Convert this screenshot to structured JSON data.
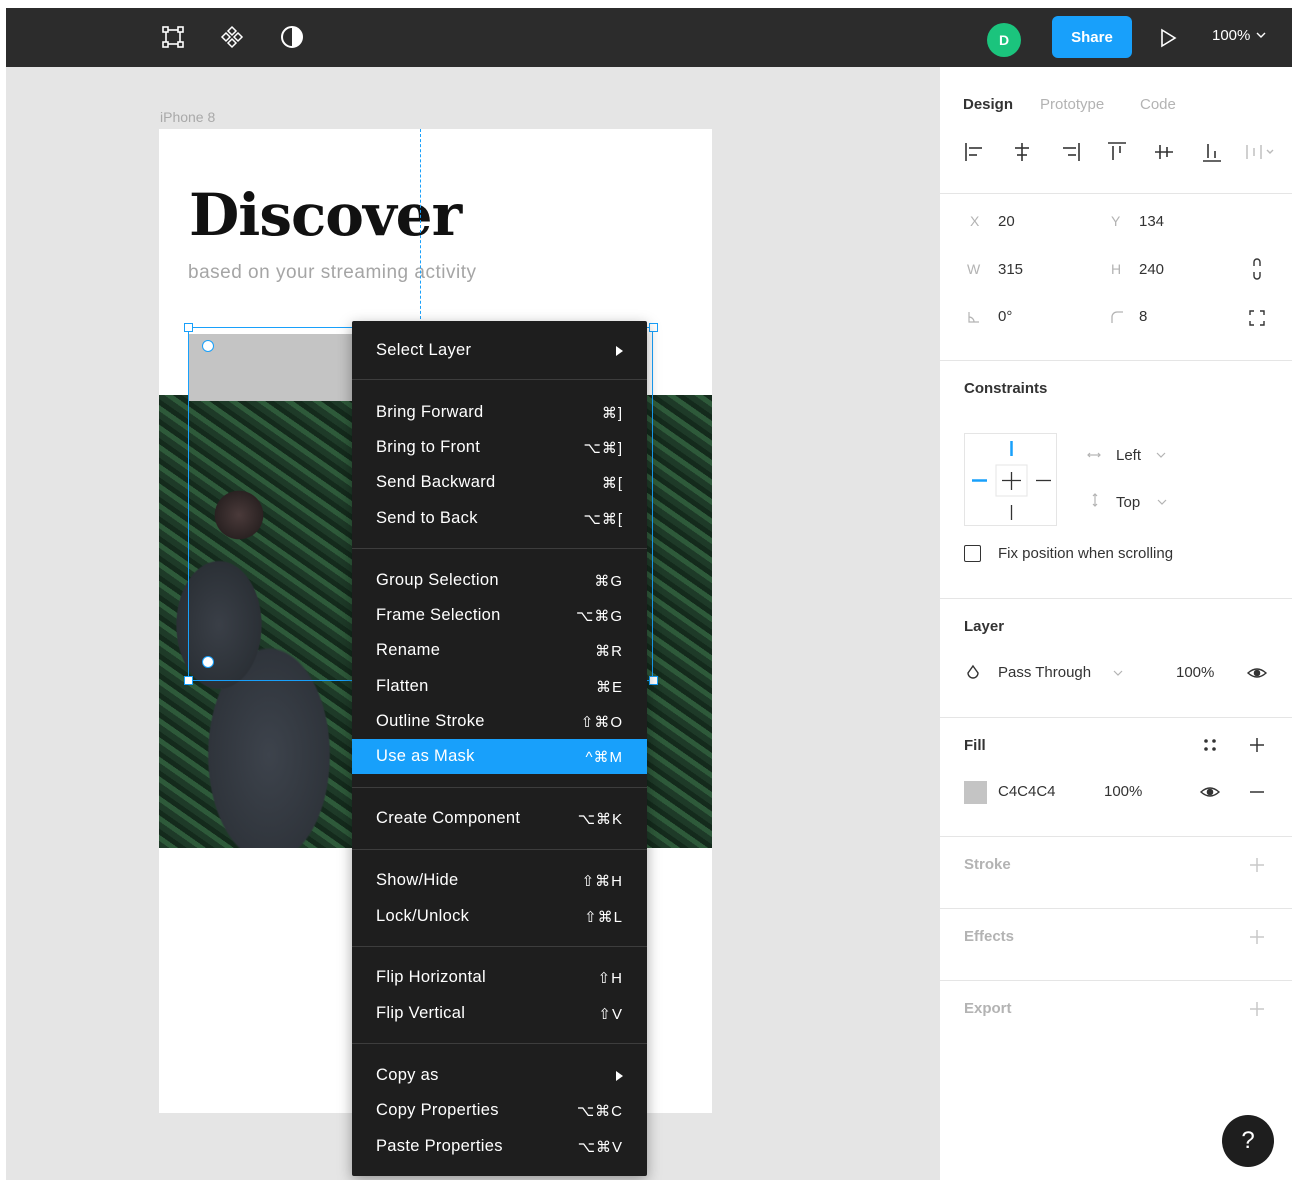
{
  "toolbar": {
    "avatar_initial": "D",
    "share_label": "Share",
    "zoom_label": "100%"
  },
  "canvas": {
    "frame_label": "iPhone 8",
    "heading": "Discover",
    "subheading": "based on your streaming activity",
    "mask_fill": "#C4C4C4"
  },
  "context_menu": {
    "items": [
      {
        "label": "Select Layer",
        "shortcut": "",
        "submenu": true
      },
      {
        "label": "Bring Forward",
        "shortcut": "⌘]"
      },
      {
        "label": "Bring to Front",
        "shortcut": "⌥⌘]"
      },
      {
        "label": "Send Backward",
        "shortcut": "⌘["
      },
      {
        "label": "Send to Back",
        "shortcut": "⌥⌘["
      },
      {
        "label": "Group Selection",
        "shortcut": "⌘G"
      },
      {
        "label": "Frame Selection",
        "shortcut": "⌥⌘G"
      },
      {
        "label": "Rename",
        "shortcut": "⌘R"
      },
      {
        "label": "Flatten",
        "shortcut": "⌘E"
      },
      {
        "label": "Outline Stroke",
        "shortcut": "⇧⌘O"
      },
      {
        "label": "Use as Mask",
        "shortcut": "^⌘M",
        "active": true
      },
      {
        "label": "Create Component",
        "shortcut": "⌥⌘K"
      },
      {
        "label": "Show/Hide",
        "shortcut": "⇧⌘H"
      },
      {
        "label": "Lock/Unlock",
        "shortcut": "⇧⌘L"
      },
      {
        "label": "Flip Horizontal",
        "shortcut": "⇧H"
      },
      {
        "label": "Flip Vertical",
        "shortcut": "⇧V"
      },
      {
        "label": "Copy as",
        "shortcut": "",
        "submenu": true
      },
      {
        "label": "Copy Properties",
        "shortcut": "⌥⌘C"
      },
      {
        "label": "Paste Properties",
        "shortcut": "⌥⌘V"
      }
    ]
  },
  "panel": {
    "tabs": [
      "Design",
      "Prototype",
      "Code"
    ],
    "active_tab": "Design",
    "position": {
      "x_label": "X",
      "x": "20",
      "y_label": "Y",
      "y": "134",
      "w_label": "W",
      "w": "315",
      "h_label": "H",
      "h": "240",
      "rotation": "0°",
      "radius": "8"
    },
    "constraints": {
      "title": "Constraints",
      "horizontal": "Left",
      "vertical": "Top",
      "fix_position_label": "Fix position when scrolling",
      "fix_position_checked": false
    },
    "layer": {
      "title": "Layer",
      "blend_mode": "Pass Through",
      "opacity": "100%"
    },
    "fill": {
      "title": "Fill",
      "hex": "C4C4C4",
      "opacity": "100%",
      "swatch_color": "#C4C4C4"
    },
    "stroke_title": "Stroke",
    "effects_title": "Effects",
    "export_title": "Export"
  },
  "help_label": "?",
  "colors": {
    "accent": "#18A0FB",
    "toolbar_bg": "#2C2C2C",
    "menu_bg": "#1E1E1E",
    "avatar": "#1BC47D"
  }
}
